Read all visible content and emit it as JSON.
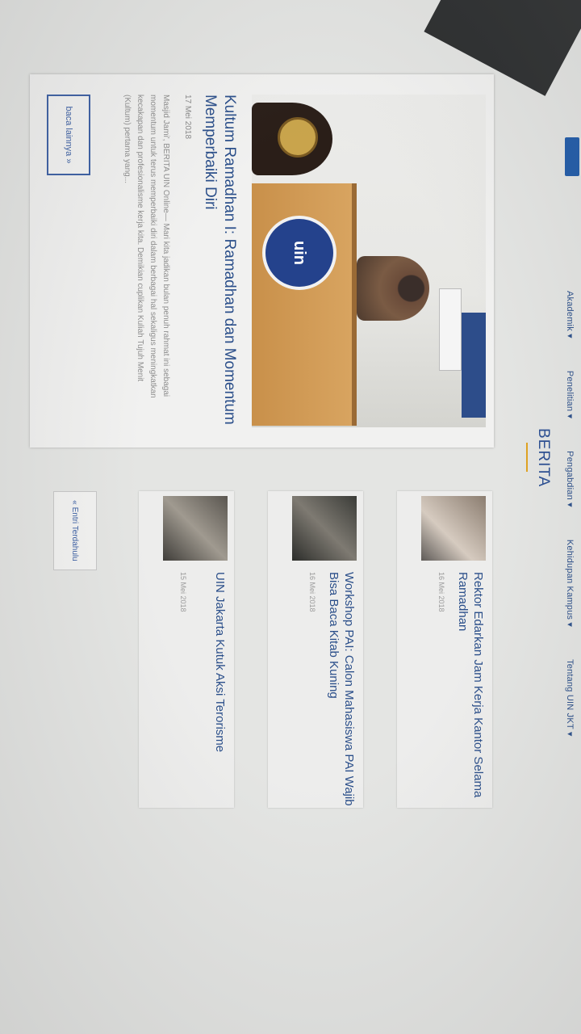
{
  "nav": {
    "items": [
      "Akademik ▾",
      "Penelitian ▾",
      "Pengabdian ▾",
      "Kehidupan Kampus ▾",
      "Tentang UIN JKT ▾"
    ]
  },
  "section": {
    "title": "BERITA"
  },
  "feature": {
    "logo_text": "uin",
    "title": "Kultum Ramadhan I: Ramadhan dan Momentum Memperbaiki Diri",
    "date": "17 Mei 2018",
    "excerpt": "Masjid Jami', BERITA UIN Online— Mari kita jadikan bulan penuh rahmat ini sebagai momentum untuk terus memperbaiki diri dalam berbagai hal sekaligus meningkatkan kecakapan dan profesionalisme kerja kita. Demikian cuplikan Kuliah Tujuh Menit (Kultum) pertama yang...",
    "read_more": "baca lainnya »"
  },
  "list": [
    {
      "title": "Rektor Edarkan Jam Kerja Kantor Selama Ramadhan",
      "date": "16 Mei 2018"
    },
    {
      "title": "Workshop PAI: Calon Mahasiswa PAI Wajib Bisa Baca Kitab Kuning",
      "date": "16 Mei 2018"
    },
    {
      "title": "UIN Jakarta Kutuk Aksi Terorisme",
      "date": "15 Mei 2018"
    }
  ],
  "earlier_button": "« Entri Terdahulu",
  "colors": {
    "accent": "#2b4f8a",
    "rule": "#e0a321"
  }
}
